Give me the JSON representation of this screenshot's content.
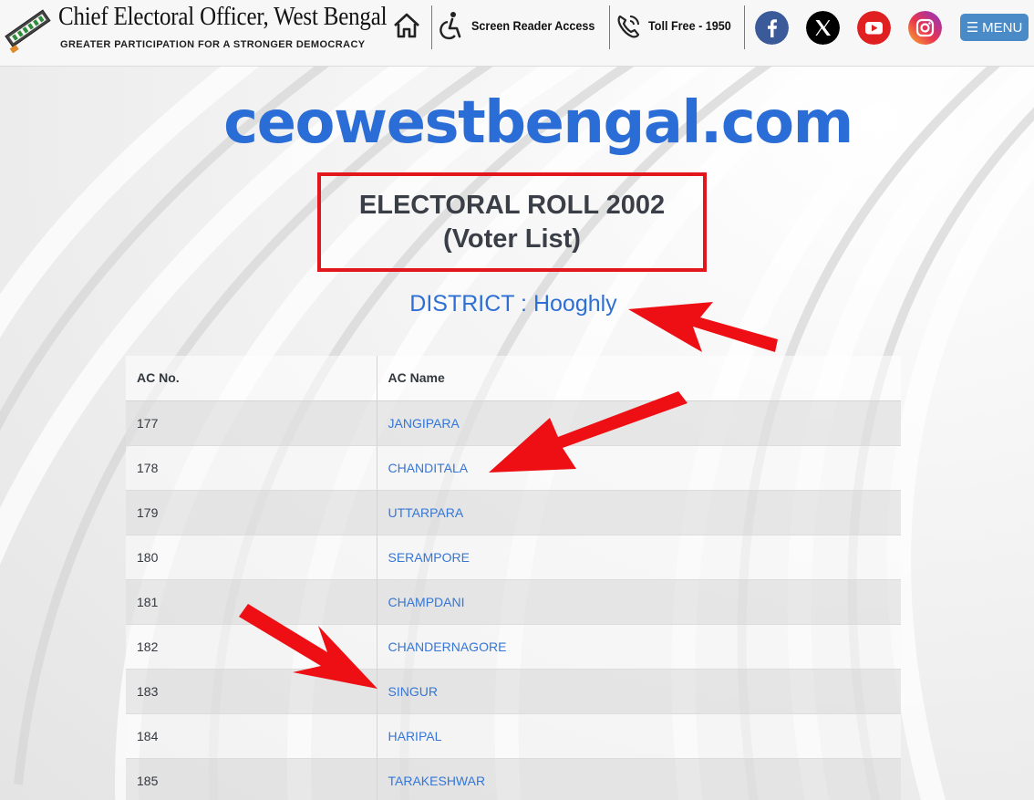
{
  "header": {
    "brand_title": "Chief Electoral Officer, West Bengal",
    "brand_subtitle": "GREATER PARTICIPATION FOR A STRONGER DEMOCRACY",
    "screen_reader_label": "Screen Reader Access",
    "toll_free_label": "Toll Free - 1950",
    "menu_label": "MENU",
    "social": [
      "facebook-icon",
      "x-icon",
      "youtube-icon",
      "instagram-icon"
    ]
  },
  "main": {
    "site_name": "ceowestbengal.com",
    "roll_title": "ELECTORAL ROLL 2002",
    "roll_subtitle": "(Voter List)",
    "district": "DISTRICT : Hooghly",
    "table": {
      "columns": [
        "AC No.",
        "AC Name"
      ],
      "rows": [
        {
          "no": "177",
          "name": "JANGIPARA"
        },
        {
          "no": "178",
          "name": "CHANDITALA"
        },
        {
          "no": "179",
          "name": "UTTARPARA"
        },
        {
          "no": "180",
          "name": "SERAMPORE"
        },
        {
          "no": "181",
          "name": "CHAMPDANI"
        },
        {
          "no": "182",
          "name": "CHANDERNAGORE"
        },
        {
          "no": "183",
          "name": "SINGUR"
        },
        {
          "no": "184",
          "name": "HARIPAL"
        },
        {
          "no": "185",
          "name": "TARAKESHWAR"
        }
      ]
    }
  },
  "colors": {
    "accent_blue": "#2b6dd6",
    "link_blue": "#3576d6",
    "highlight_red": "#e2161d",
    "menu_button": "#4a8ac6"
  }
}
